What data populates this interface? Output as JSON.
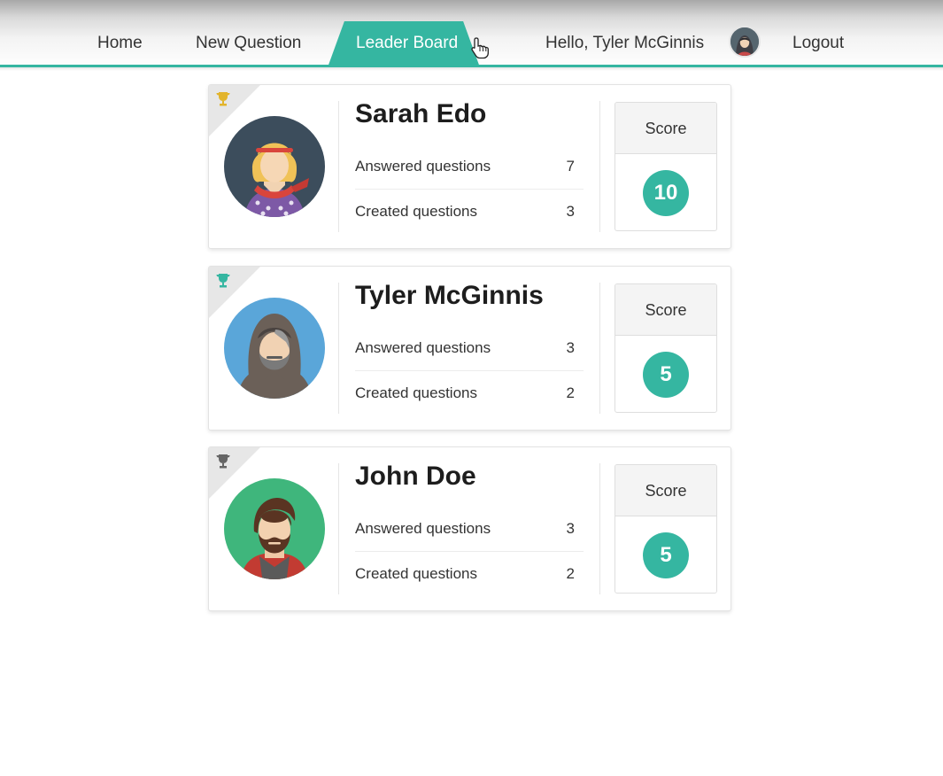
{
  "nav": {
    "home_label": "Home",
    "new_question_label": "New Question",
    "leaderboard_label": "Leader Board",
    "greeting": "Hello, Tyler McGinnis",
    "logout_label": "Logout"
  },
  "leaderboard": {
    "entries": [
      {
        "rank": 1,
        "trophy_color": "#e2b42b",
        "name": "Sarah Edo",
        "answered_label": "Answered questions",
        "answered": "7",
        "created_label": "Created questions",
        "created": "3",
        "score_label": "Score",
        "score": "10"
      },
      {
        "rank": 2,
        "trophy_color": "#35b6a1",
        "name": "Tyler McGinnis",
        "answered_label": "Answered questions",
        "answered": "3",
        "created_label": "Created questions",
        "created": "2",
        "score_label": "Score",
        "score": "5"
      },
      {
        "rank": 3,
        "trophy_color": "#666666",
        "name": "John Doe",
        "answered_label": "Answered questions",
        "answered": "3",
        "created_label": "Created questions",
        "created": "2",
        "score_label": "Score",
        "score": "5"
      }
    ]
  },
  "colors": {
    "accent": "#35b6a1"
  },
  "icons": [
    "trophy-icon",
    "user-avatar",
    "cursor-pointer-icon"
  ]
}
